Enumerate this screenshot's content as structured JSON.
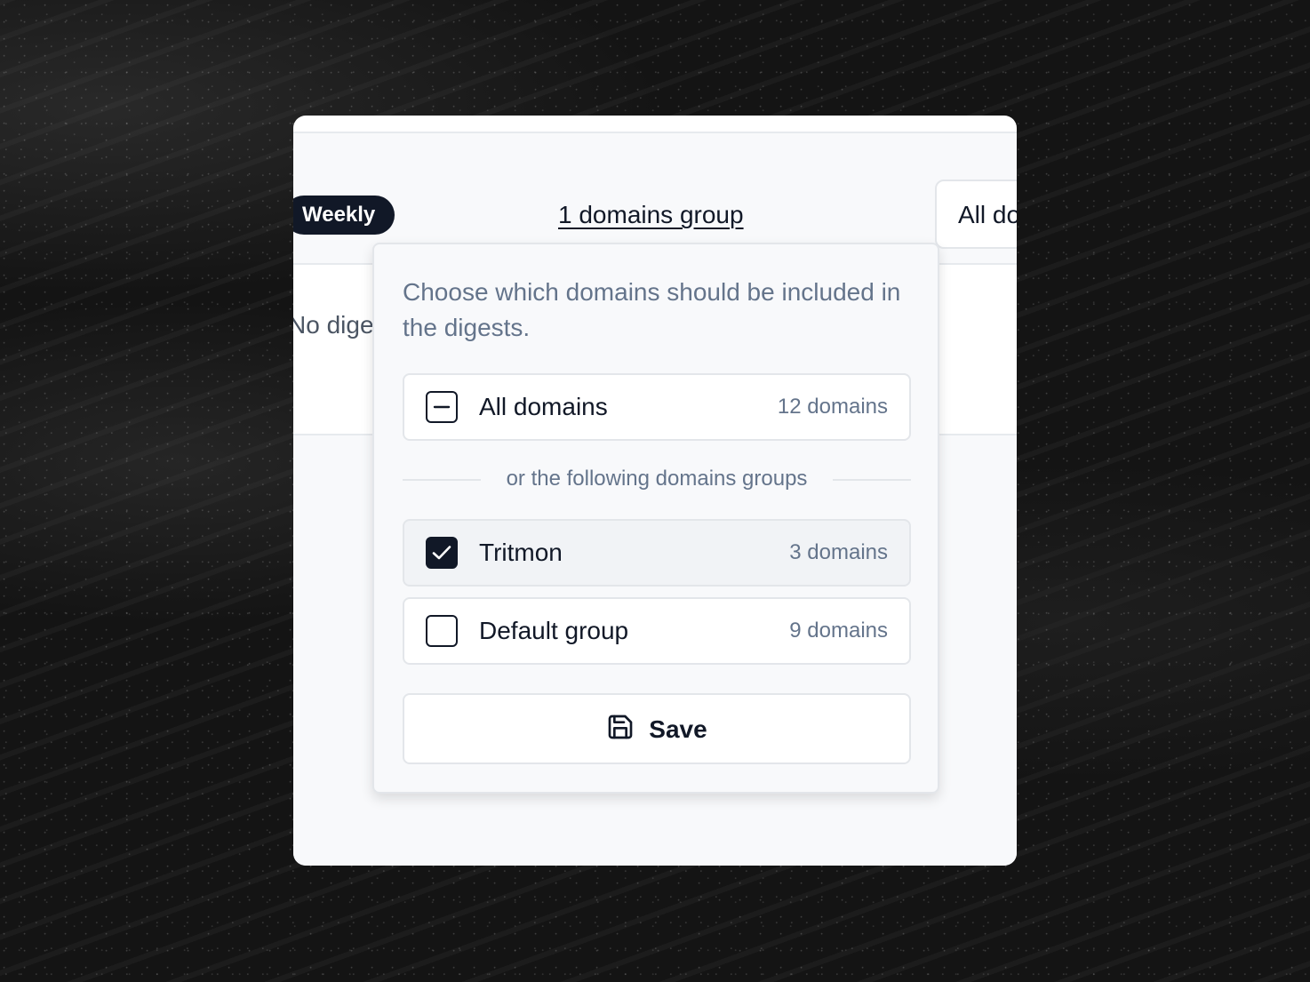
{
  "header": {
    "frequency_badge": "Weekly",
    "domains_group_link": "1 domains group",
    "domains_select_value": "All domains"
  },
  "content": {
    "empty_message": "No digests"
  },
  "popover": {
    "description": "Choose which domains should be included in the digests.",
    "all_option": {
      "label": "All domains",
      "count": "12 domains",
      "state": "indeterminate"
    },
    "divider_text": "or the following domains groups",
    "groups": [
      {
        "label": "Tritmon",
        "count": "3 domains",
        "checked": true
      },
      {
        "label": "Default group",
        "count": "9 domains",
        "checked": false
      }
    ],
    "save_label": "Save",
    "save_icon": "floppy-disk-icon"
  },
  "colors": {
    "accent": "#111827",
    "muted_text": "#64748b",
    "border": "#e3e6ea",
    "panel_bg": "#f8f9fb"
  }
}
